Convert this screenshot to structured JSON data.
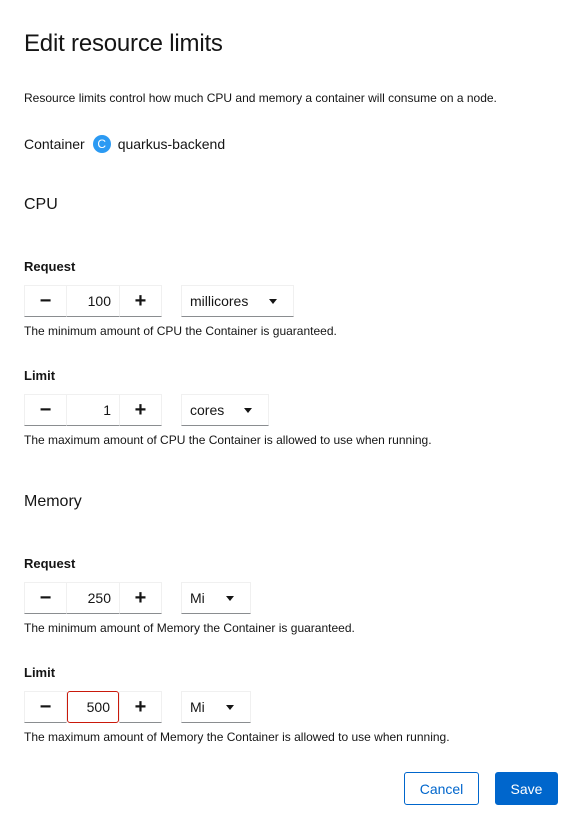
{
  "dialog": {
    "title": "Edit resource limits",
    "description": "Resource limits control how much CPU and memory a container will consume on a node.",
    "container_label": "Container",
    "container_badge": "C",
    "container_name": "quarkus-backend"
  },
  "cpu": {
    "heading": "CPU",
    "request": {
      "label": "Request",
      "minus": "−",
      "value": "100",
      "plus": "+",
      "unit": "millicores",
      "helper": "The minimum amount of CPU the Container is guaranteed."
    },
    "limit": {
      "label": "Limit",
      "minus": "−",
      "value": "1",
      "plus": "+",
      "unit": "cores",
      "helper": "The maximum amount of CPU the Container is allowed to use when running."
    }
  },
  "memory": {
    "heading": "Memory",
    "request": {
      "label": "Request",
      "minus": "−",
      "value": "250",
      "plus": "+",
      "unit": "Mi",
      "helper": "The minimum amount of Memory the Container is guaranteed."
    },
    "limit": {
      "label": "Limit",
      "minus": "−",
      "value": "500",
      "plus": "+",
      "unit": "Mi",
      "helper": "The maximum amount of Memory the Container is allowed to use when running."
    }
  },
  "actions": {
    "cancel": "Cancel",
    "save": "Save"
  },
  "colors": {
    "primary": "#0066cc",
    "badge": "#2b9af3",
    "error_border": "#c9190b"
  }
}
